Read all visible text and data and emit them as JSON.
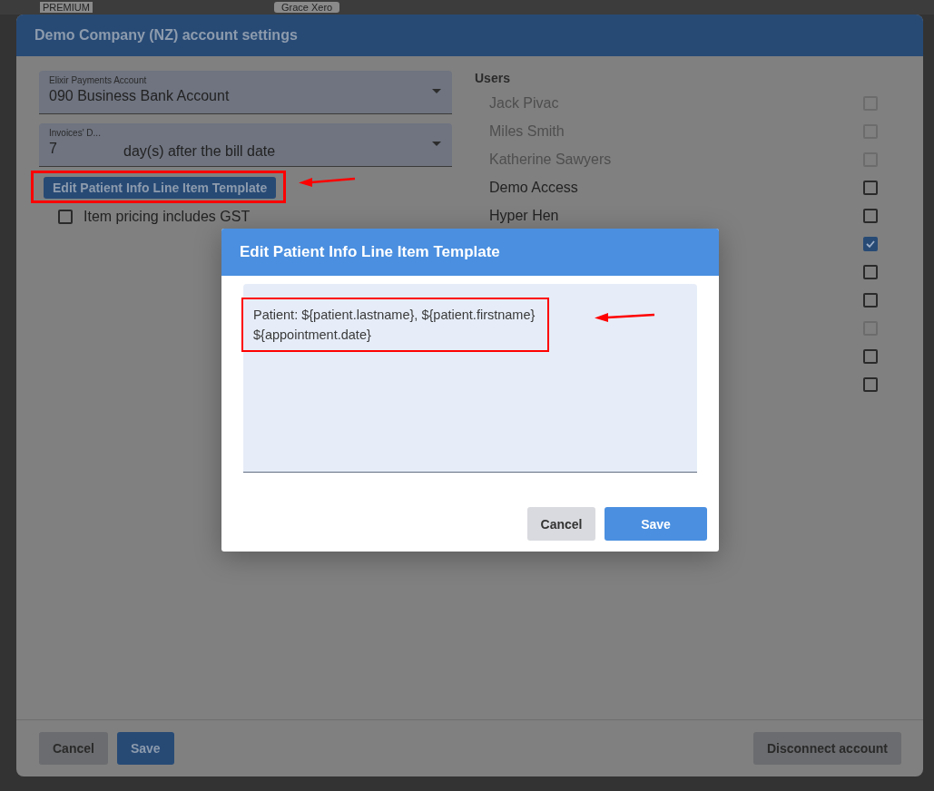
{
  "background": {
    "plan_label": "PREMIUM",
    "user_chip": "Grace Xero"
  },
  "settings_dialog": {
    "title": "Demo Company (NZ) account settings",
    "payments_account": {
      "label": "Elixir Payments Account",
      "value": "090 Business Bank Account"
    },
    "due": {
      "label": "Invoices' D...",
      "value": "7",
      "unit": "day(s) after the bill date"
    },
    "template_button": "Edit Patient Info Line Item Template",
    "gst_checkbox": {
      "label": "Item pricing includes GST",
      "checked": false
    },
    "users_heading": "Users",
    "users": [
      {
        "name": "Jack Pivac",
        "checked": false,
        "disabled": true
      },
      {
        "name": "Miles Smith",
        "checked": false,
        "disabled": true
      },
      {
        "name": "Katherine Sawyers",
        "checked": false,
        "disabled": true
      },
      {
        "name": "Demo Access",
        "checked": false,
        "disabled": false
      },
      {
        "name": "Hyper Hen",
        "checked": false,
        "disabled": false
      },
      {
        "checked": true,
        "disabled": false
      },
      {
        "checked": false,
        "disabled": false
      },
      {
        "checked": false,
        "disabled": false
      },
      {
        "checked": false,
        "disabled": true
      },
      {
        "checked": false,
        "disabled": false
      },
      {
        "checked": false,
        "disabled": false
      }
    ],
    "buttons": {
      "cancel": "Cancel",
      "save": "Save",
      "disconnect": "Disconnect account"
    }
  },
  "template_dialog": {
    "title": "Edit Patient Info Line Item Template",
    "value": "Patient: ${patient.lastname}, ${patient.firstname}\n${appointment.date}",
    "buttons": {
      "cancel": "Cancel",
      "save": "Save"
    }
  }
}
